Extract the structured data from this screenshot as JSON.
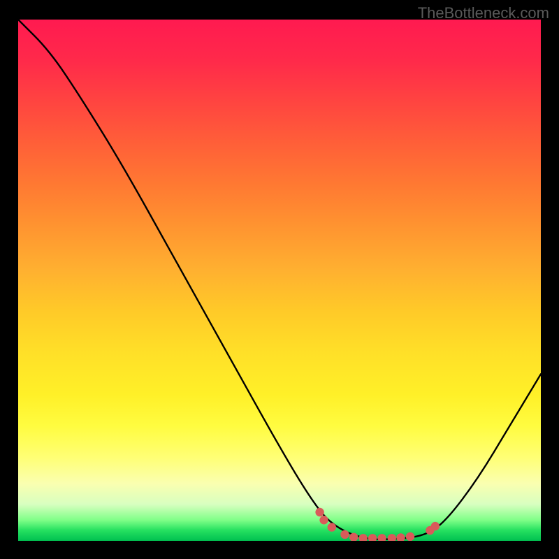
{
  "watermark": "TheBottleneck.com",
  "chart_data": {
    "type": "line",
    "title": "",
    "xlabel": "",
    "ylabel": "",
    "x_range": [
      0,
      100
    ],
    "y_range": [
      0,
      100
    ],
    "curve_points": [
      {
        "x": 0,
        "y": 100
      },
      {
        "x": 6,
        "y": 94
      },
      {
        "x": 12,
        "y": 85
      },
      {
        "x": 20,
        "y": 72
      },
      {
        "x": 30,
        "y": 54
      },
      {
        "x": 40,
        "y": 36
      },
      {
        "x": 50,
        "y": 18
      },
      {
        "x": 56,
        "y": 8
      },
      {
        "x": 60,
        "y": 3
      },
      {
        "x": 66,
        "y": 0.3
      },
      {
        "x": 72,
        "y": 0.3
      },
      {
        "x": 78,
        "y": 1
      },
      {
        "x": 82,
        "y": 4
      },
      {
        "x": 88,
        "y": 12
      },
      {
        "x": 94,
        "y": 22
      },
      {
        "x": 100,
        "y": 32
      }
    ],
    "dot_points": [
      {
        "x": 57.7,
        "y": 5.5
      },
      {
        "x": 58.5,
        "y": 4.0
      },
      {
        "x": 60.0,
        "y": 2.6
      },
      {
        "x": 62.5,
        "y": 1.2
      },
      {
        "x": 64.2,
        "y": 0.7
      },
      {
        "x": 66.0,
        "y": 0.5
      },
      {
        "x": 67.8,
        "y": 0.5
      },
      {
        "x": 69.6,
        "y": 0.5
      },
      {
        "x": 71.5,
        "y": 0.5
      },
      {
        "x": 73.2,
        "y": 0.6
      },
      {
        "x": 75.0,
        "y": 0.8
      },
      {
        "x": 78.8,
        "y": 2.0
      },
      {
        "x": 79.8,
        "y": 2.8
      }
    ],
    "gradient_stops": [
      {
        "pos": 0,
        "color": "#ff1a50"
      },
      {
        "pos": 50,
        "color": "#ffca28"
      },
      {
        "pos": 85,
        "color": "#ffff75"
      },
      {
        "pos": 100,
        "color": "#00c050"
      }
    ]
  }
}
